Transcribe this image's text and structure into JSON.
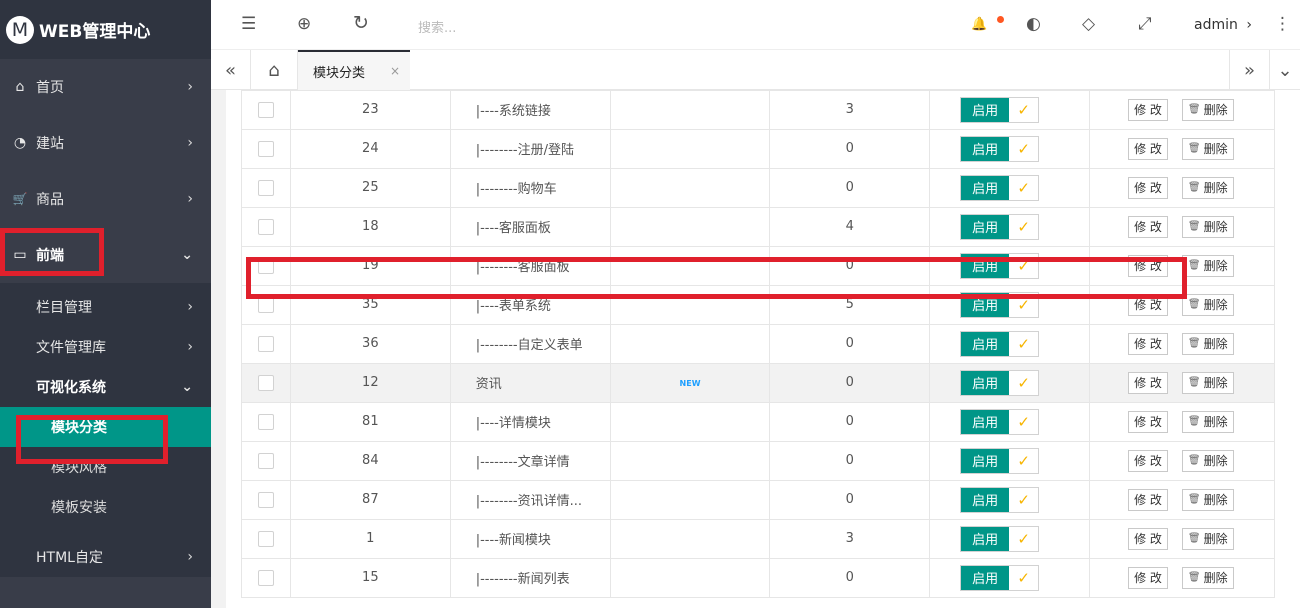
{
  "app": {
    "logo_letter": "M",
    "title": "WEB管理中心"
  },
  "sidebar": {
    "items": [
      {
        "label": "首页",
        "icon": "home-icon",
        "glyph": "⌂",
        "arrow": "›"
      },
      {
        "label": "建站",
        "icon": "dashboard-icon",
        "glyph": "◔",
        "arrow": "›"
      },
      {
        "label": "商品",
        "icon": "cart-icon",
        "glyph": "🛒",
        "arrow": "›"
      },
      {
        "label": "前端",
        "icon": "window-icon",
        "glyph": "▭",
        "arrow": "⌄"
      }
    ],
    "sub": [
      {
        "label": "栏目管理",
        "arrow": "›"
      },
      {
        "label": "文件管理库",
        "arrow": "›"
      },
      {
        "label": "可视化系统",
        "arrow": "⌄"
      }
    ],
    "subsub": [
      "模块分类",
      "模块风格",
      "模板安装"
    ],
    "sub_after": [
      {
        "label": "HTML自定",
        "arrow": "›"
      }
    ]
  },
  "header": {
    "menu_glyph": "☰",
    "globe_glyph": "⊕",
    "refresh_glyph": "↻",
    "search_placeholder": "搜索...",
    "bell_glyph": "🔔",
    "theme_glyph": "◐",
    "tag_glyph": "◇",
    "fullscreen_glyph": "⤢",
    "user": "admin",
    "user_arrow": "›",
    "more_glyph": "⋮"
  },
  "tabs": {
    "prev_glyph": "«",
    "home_glyph": "⌂",
    "active": "模块分类",
    "close_glyph": "×",
    "next_glyph": "»",
    "dropdown_glyph": "⌄"
  },
  "table": {
    "status_label": "启用",
    "check_glyph": "✓",
    "edit_label": "修 改",
    "delete_label": "删除",
    "delete_glyph": "🗑",
    "rows": [
      {
        "id": "23",
        "name": "|----系统链接",
        "count": "3",
        "icon": ""
      },
      {
        "id": "24",
        "name": "|--------注册/登陆",
        "count": "0",
        "icon": ""
      },
      {
        "id": "25",
        "name": "|--------购物车",
        "count": "0",
        "icon": ""
      },
      {
        "id": "18",
        "name": "|----客服面板",
        "count": "4",
        "icon": ""
      },
      {
        "id": "19",
        "name": "|--------客服面板",
        "count": "0",
        "icon": ""
      },
      {
        "id": "35",
        "name": "|----表单系统",
        "count": "5",
        "icon": ""
      },
      {
        "id": "36",
        "name": "|--------自定义表单",
        "count": "0",
        "icon": ""
      },
      {
        "id": "12",
        "name": "资讯",
        "count": "0",
        "icon": "NEW"
      },
      {
        "id": "81",
        "name": "|----详情模块",
        "count": "0",
        "icon": ""
      },
      {
        "id": "84",
        "name": "|--------文章详情",
        "count": "0",
        "icon": ""
      },
      {
        "id": "87",
        "name": "|--------资讯详情...",
        "count": "0",
        "icon": ""
      },
      {
        "id": "1",
        "name": "|----新闻模块",
        "count": "3",
        "icon": ""
      },
      {
        "id": "15",
        "name": "|--------新闻列表",
        "count": "0",
        "icon": ""
      }
    ]
  },
  "colors": {
    "accent": "#009688",
    "sidebar": "#393d49",
    "highlight": "#e0202c"
  }
}
